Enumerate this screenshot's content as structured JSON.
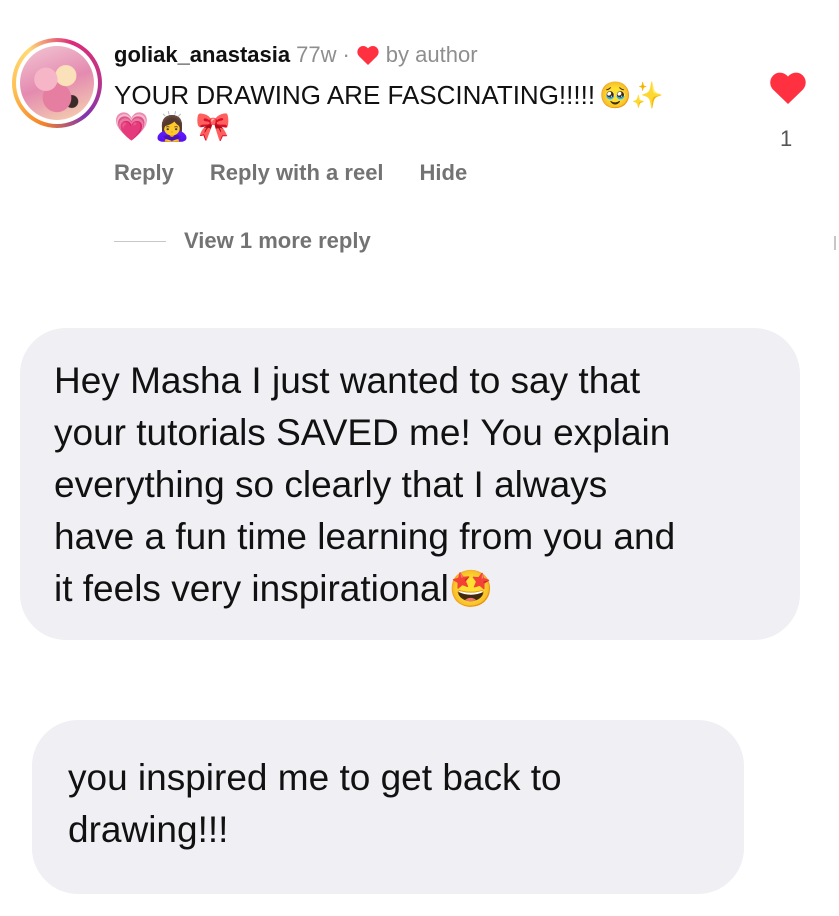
{
  "comment": {
    "username": "goliak_anastasia",
    "age": "77w",
    "separator": "·",
    "liked_by": "by author",
    "text": "YOUR DRAWING ARE FASCINATING!!!!!",
    "text_emojis": "🥹✨",
    "emoji_row": "💗🙇‍♀️🎀",
    "like_count": "1",
    "like_color": "#ff3040",
    "actions": {
      "reply": "Reply",
      "reply_reel": "Reply with a reel",
      "hide": "Hide"
    },
    "view_more": "View 1 more reply"
  },
  "messages": [
    {
      "text": "Hey Masha I just wanted to say that\nyour tutorials SAVED me! You explain\neverything so clearly that I always\nhave a fun time learning from you and\nit feels very inspirational",
      "emoji": "🤩"
    },
    {
      "text": "you inspired me to get back to\ndrawing!!!"
    }
  ]
}
